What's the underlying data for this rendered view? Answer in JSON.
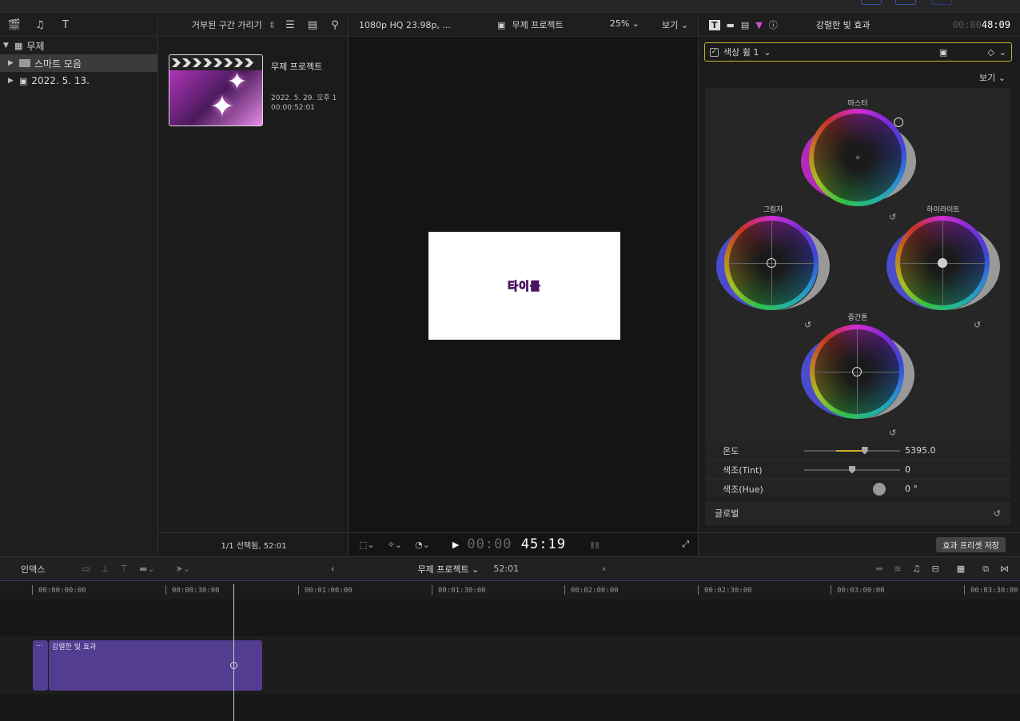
{
  "browser": {
    "libraries": [
      {
        "label": "무제",
        "icon": "library-grid-icon",
        "expanded": true,
        "selected": false
      },
      {
        "label": "스마트 모음",
        "icon": "folder-icon",
        "expanded": false,
        "selected": true
      },
      {
        "label": "2022. 5. 13.",
        "icon": "event-icon",
        "expanded": false,
        "selected": false
      }
    ],
    "filter_label": "거부된 구간 가리기",
    "clip": {
      "name": "무제 프로젝트",
      "date": "2022. 5. 29. 오후 1",
      "duration": "00:00:52:01"
    },
    "selection_status": "1/1 선택됨, 52:01"
  },
  "viewer": {
    "format": "1080p HQ 23.98p, ...",
    "project": "무제 프로젝트",
    "zoom": "25%",
    "view_label": "보기",
    "frame_title": "타이틀",
    "timecode_dim": "00:00",
    "timecode": "45:19"
  },
  "inspector": {
    "title": "강렬한 빛 효과",
    "timecode_dim": "00:00",
    "timecode": "48:09",
    "effect_name": "색상 휠 1",
    "effect_enabled": true,
    "view_label": "보기",
    "wheels": {
      "master": "마스터",
      "shadows": "그림자",
      "highlights": "하이라이트",
      "midtones": "중간톤"
    },
    "params": [
      {
        "label": "온도",
        "value": "5395.0",
        "level": 0.63
      },
      {
        "label": "색조(Tint)",
        "value": "0",
        "level": 0.5
      },
      {
        "label": "색조(Hue)",
        "value": "0 °",
        "level": 0.0
      }
    ],
    "global_label": "글로벌",
    "save_preset": "효과 프리셋 저장"
  },
  "timeline": {
    "index_label": "인덱스",
    "project": "무제 프로젝트",
    "duration": "52:01",
    "ruler": [
      "00:00:00:00",
      "00:00:30:00",
      "00:01:00:00",
      "00:01:30:00",
      "00:02:00:00",
      "00:02:30:00",
      "00:03:00:00",
      "00:03:30:00"
    ],
    "clip_label": "강렬한 빛 효과",
    "clip_start_label": "..."
  },
  "colors": {
    "accent": "#c9b12d",
    "clip": "#523d91",
    "timeline_border": "#4a2f80"
  }
}
